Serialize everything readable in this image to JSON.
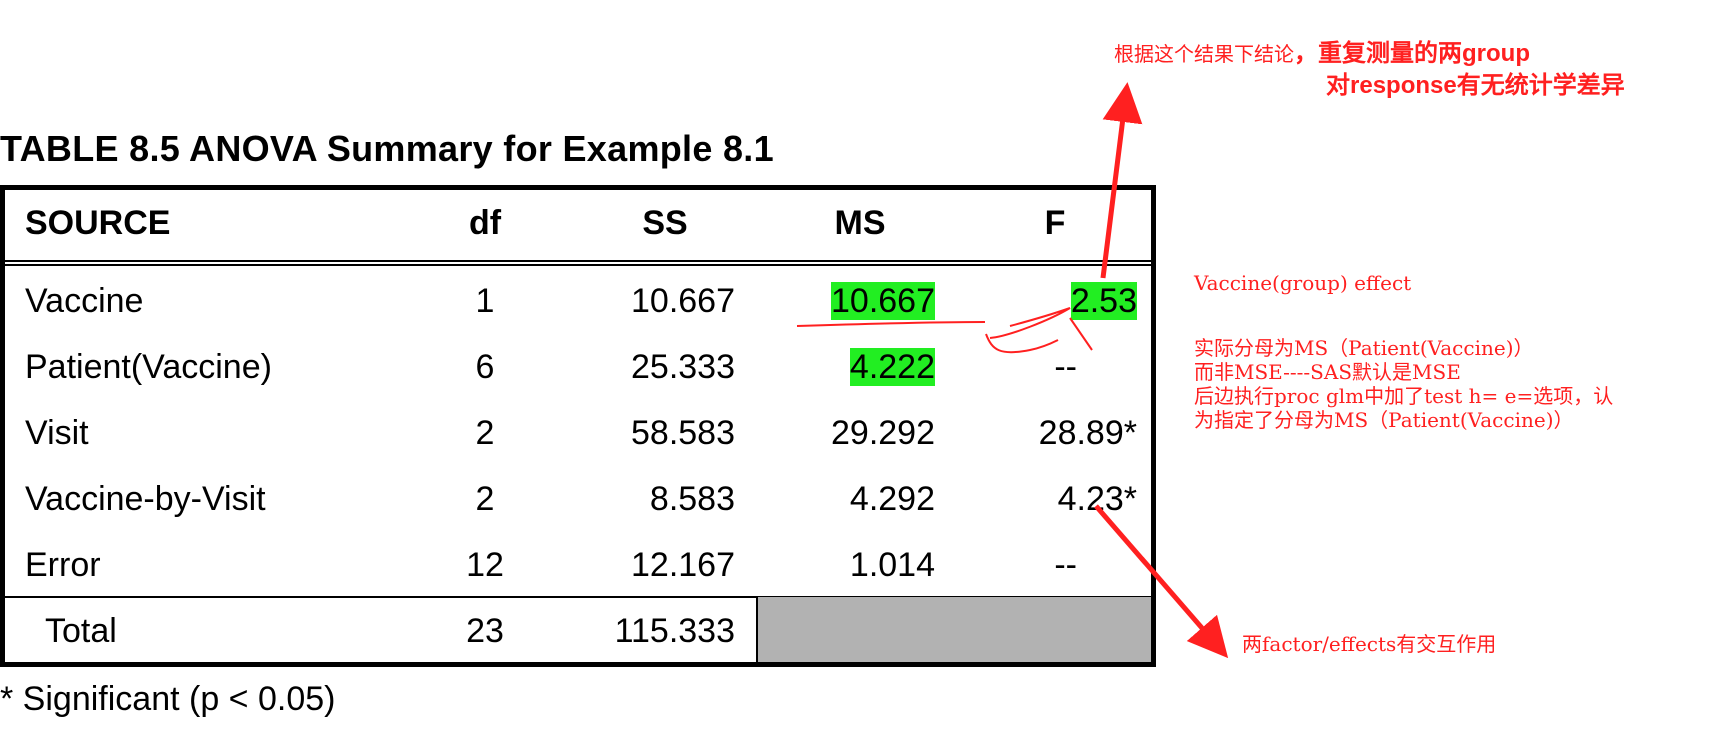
{
  "table_title": "TABLE 8.5  ANOVA Summary for Example 8.1",
  "headers": {
    "source": "SOURCE",
    "df": "df",
    "ss": "SS",
    "ms": "MS",
    "f": "F"
  },
  "rows": [
    {
      "source": "Vaccine",
      "df": "1",
      "ss": "10.667",
      "ms": "10.667",
      "f": "2.53"
    },
    {
      "source": "Patient(Vaccine)",
      "df": "6",
      "ss": "25.333",
      "ms": "4.222",
      "f": "--"
    },
    {
      "source": "Visit",
      "df": "2",
      "ss": "58.583",
      "ms": "29.292",
      "f": "28.89*"
    },
    {
      "source": "Vaccine-by-Visit",
      "df": "2",
      "ss": "8.583",
      "ms": "4.292",
      "f": "4.23*"
    },
    {
      "source": "Error",
      "df": "12",
      "ss": "12.167",
      "ms": "1.014",
      "f": "--"
    }
  ],
  "total": {
    "source": "Total",
    "df": "23",
    "ss": "115.333"
  },
  "footnote": "*  Significant (p < 0.05)",
  "annotations": {
    "top_line1_a": "根据这个结果下结论",
    "top_line1_b": "，重复测量的两",
    "top_line1_c": "group",
    "top_line2_a": "对",
    "top_line2_b": "response",
    "top_line2_c": "有无统计学差异",
    "vaccine_effect": "Vaccine(group) effect",
    "note_line1": "实际分母为MS（Patient(Vaccine)）",
    "note_line2": "而非MSE----SAS默认是MSE",
    "note_line3": "后边执行proc glm中加了test h= e=选项，认",
    "note_line4": "为指定了分母为MS（Patient(Vaccine)）",
    "interaction": "两factor/effects有交互作用"
  },
  "colors": {
    "highlight": "#22ee22",
    "annotation": "#ff2020",
    "total_fill": "#b2b2b2"
  }
}
